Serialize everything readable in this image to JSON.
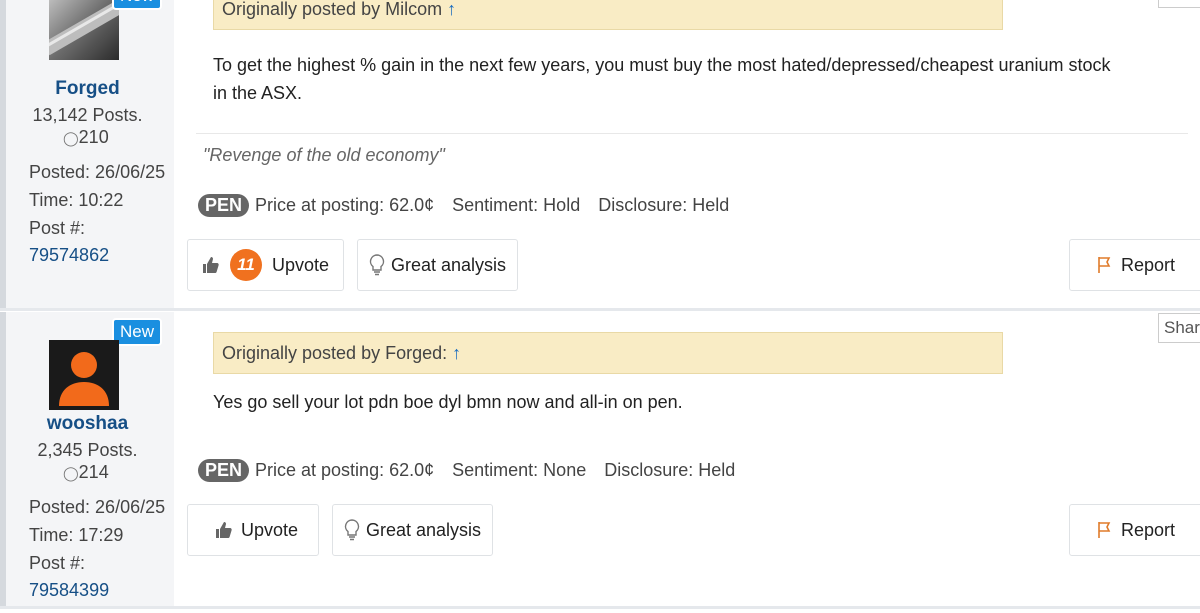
{
  "posts": [
    {
      "badge": "New",
      "username": "Forged",
      "posts_count": "13,142 Posts.",
      "reputation": "210",
      "posted": "Posted: 26/06/25",
      "time": "Time: 10:22",
      "post_label": "Post #:",
      "post_number": "79574862",
      "quote_text": "Originally posted by Milcom",
      "quote_arrow": "↑",
      "body_lines": [
        "To get the highest % gain in the next few years, you must buy the most hated/depressed/cheapest uranium stock",
        "in the ASX."
      ],
      "signature": "\"Revenge of the old economy\"",
      "ticker": "PEN",
      "price": "Price at posting: 62.0¢",
      "sentiment": "Sentiment: Hold",
      "disclosure": "Disclosure: Held",
      "upvote_count": "11",
      "upvote_label": "Upvote",
      "great_label": "Great analysis",
      "report_label": "Report"
    },
    {
      "badge": "New",
      "username": "wooshaa",
      "posts_count": "2,345 Posts.",
      "reputation": "214",
      "posted": "Posted: 26/06/25",
      "time": "Time: 17:29",
      "post_label": "Post #:",
      "post_number": "79584399",
      "quote_text": "Originally posted by Forged:",
      "quote_arrow": "↑",
      "body_lines": [
        "Yes go sell your lot pdn boe dyl bmn now and all-in on pen."
      ],
      "ticker": "PEN",
      "price": "Price at posting: 62.0¢",
      "sentiment": "Sentiment: None",
      "disclosure": "Disclosure: Held",
      "upvote_label": "Upvote",
      "great_label": "Great analysis",
      "report_label": "Report",
      "share_label": "Share"
    }
  ],
  "colors": {
    "accent": "#1a8fe0",
    "username": "#164f86",
    "quote_bg": "#f9ecc5",
    "count_badge": "#f0711f",
    "report_flag": "#e07b2a"
  },
  "icons": [
    "thumbs-up-icon",
    "lightbulb-icon",
    "flag-icon",
    "person-icon"
  ]
}
